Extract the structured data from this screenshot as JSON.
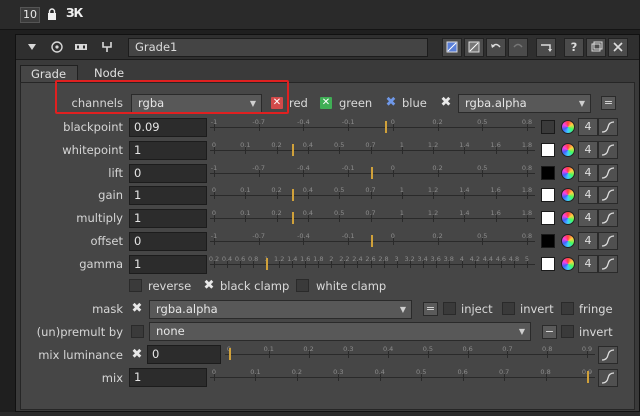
{
  "topbar": {
    "count": "10",
    "icons": [
      "lock-icon",
      "expand-icon"
    ]
  },
  "node": {
    "name": "Grade1"
  },
  "tabs": [
    {
      "label": "Grade"
    },
    {
      "label": "Node"
    }
  ],
  "channels": {
    "label": "channels",
    "value": "rgba",
    "red": "red",
    "green": "green",
    "blue": "blue",
    "alpha_channel": "rgba.alpha"
  },
  "knobs": [
    {
      "label": "blackpoint",
      "value": "0.09",
      "ticks": [
        "-1",
        "-0.7",
        "-0.4",
        "-0.1",
        "0",
        "0.2",
        "0.5",
        "0.8"
      ],
      "handle": 0.09,
      "min": -1,
      "max": 1,
      "swatch": "#3a3a3a",
      "count": "4"
    },
    {
      "label": "whitepoint",
      "value": "1",
      "ticks": [
        "0",
        "0.1",
        "0.2",
        "0.4",
        "0.5",
        "0.7",
        "1",
        "1.2",
        "1.4",
        "1.6",
        "1.8"
      ],
      "handle": 1,
      "min": 0,
      "max": 4,
      "swatch": "#ffffff",
      "count": "4"
    },
    {
      "label": "lift",
      "value": "0",
      "ticks": [
        "-1",
        "-0.7",
        "-0.4",
        "-0.1",
        "0",
        "0.2",
        "0.5",
        "0.8"
      ],
      "handle": 0,
      "min": -1,
      "max": 1,
      "swatch": "#000000",
      "count": "4"
    },
    {
      "label": "gain",
      "value": "1",
      "ticks": [
        "0",
        "0.1",
        "0.2",
        "0.4",
        "0.5",
        "0.7",
        "1",
        "1.2",
        "1.4",
        "1.6",
        "1.8"
      ],
      "handle": 1,
      "min": 0,
      "max": 4,
      "swatch": "#ffffff",
      "count": "4"
    },
    {
      "label": "multiply",
      "value": "1",
      "ticks": [
        "0",
        "0.1",
        "0.2",
        "0.4",
        "0.5",
        "0.7",
        "1",
        "1.2",
        "1.4",
        "1.6",
        "1.8"
      ],
      "handle": 1,
      "min": 0,
      "max": 4,
      "swatch": "#ffffff",
      "count": "4"
    },
    {
      "label": "offset",
      "value": "0",
      "ticks": [
        "-1",
        "-0.7",
        "-0.4",
        "-0.1",
        "0",
        "0.2",
        "0.5",
        "0.8"
      ],
      "handle": 0,
      "min": -1,
      "max": 1,
      "swatch": "#000000",
      "count": "4"
    },
    {
      "label": "gamma",
      "value": "1",
      "ticks": [
        "0.2",
        "0.4",
        "0.6",
        "0.8",
        "1",
        "1.2",
        "1.4",
        "1.6",
        "1.8",
        "2",
        "2.2",
        "2.4",
        "2.6",
        "2.8",
        "3",
        "3.2",
        "3.4",
        "3.6",
        "3.8",
        "4",
        "4.2",
        "4.4",
        "4.6",
        "4.8",
        "5"
      ],
      "handle": 1,
      "min": 0.2,
      "max": 5,
      "swatch": "#ffffff",
      "count": "4"
    }
  ],
  "options": {
    "reverse": "reverse",
    "black_clamp": "black clamp",
    "white_clamp": "white clamp"
  },
  "mask": {
    "label": "mask",
    "value": "rgba.alpha",
    "inject": "inject",
    "invert": "invert",
    "fringe": "fringe"
  },
  "premult": {
    "label": "(un)premult by",
    "value": "none",
    "invert": "invert"
  },
  "mix_luminance": {
    "label": "mix luminance",
    "value": "0",
    "ticks": [
      "0",
      "0.1",
      "0.2",
      "0.3",
      "0.4",
      "0.5",
      "0.6",
      "0.7",
      "0.8",
      "0.9"
    ],
    "handle": 0
  },
  "mix": {
    "label": "mix",
    "value": "1",
    "ticks": [
      "0",
      "0.1",
      "0.2",
      "0.3",
      "0.4",
      "0.5",
      "0.6",
      "0.7",
      "0.8",
      "0.9"
    ],
    "handle": 1
  },
  "colors": {
    "highlight_box": "#e02020",
    "slider_handle": "#d0a13a",
    "red_check": "#d24a4a",
    "green_check": "#3fae55",
    "blue_check": "#6f98e8"
  }
}
